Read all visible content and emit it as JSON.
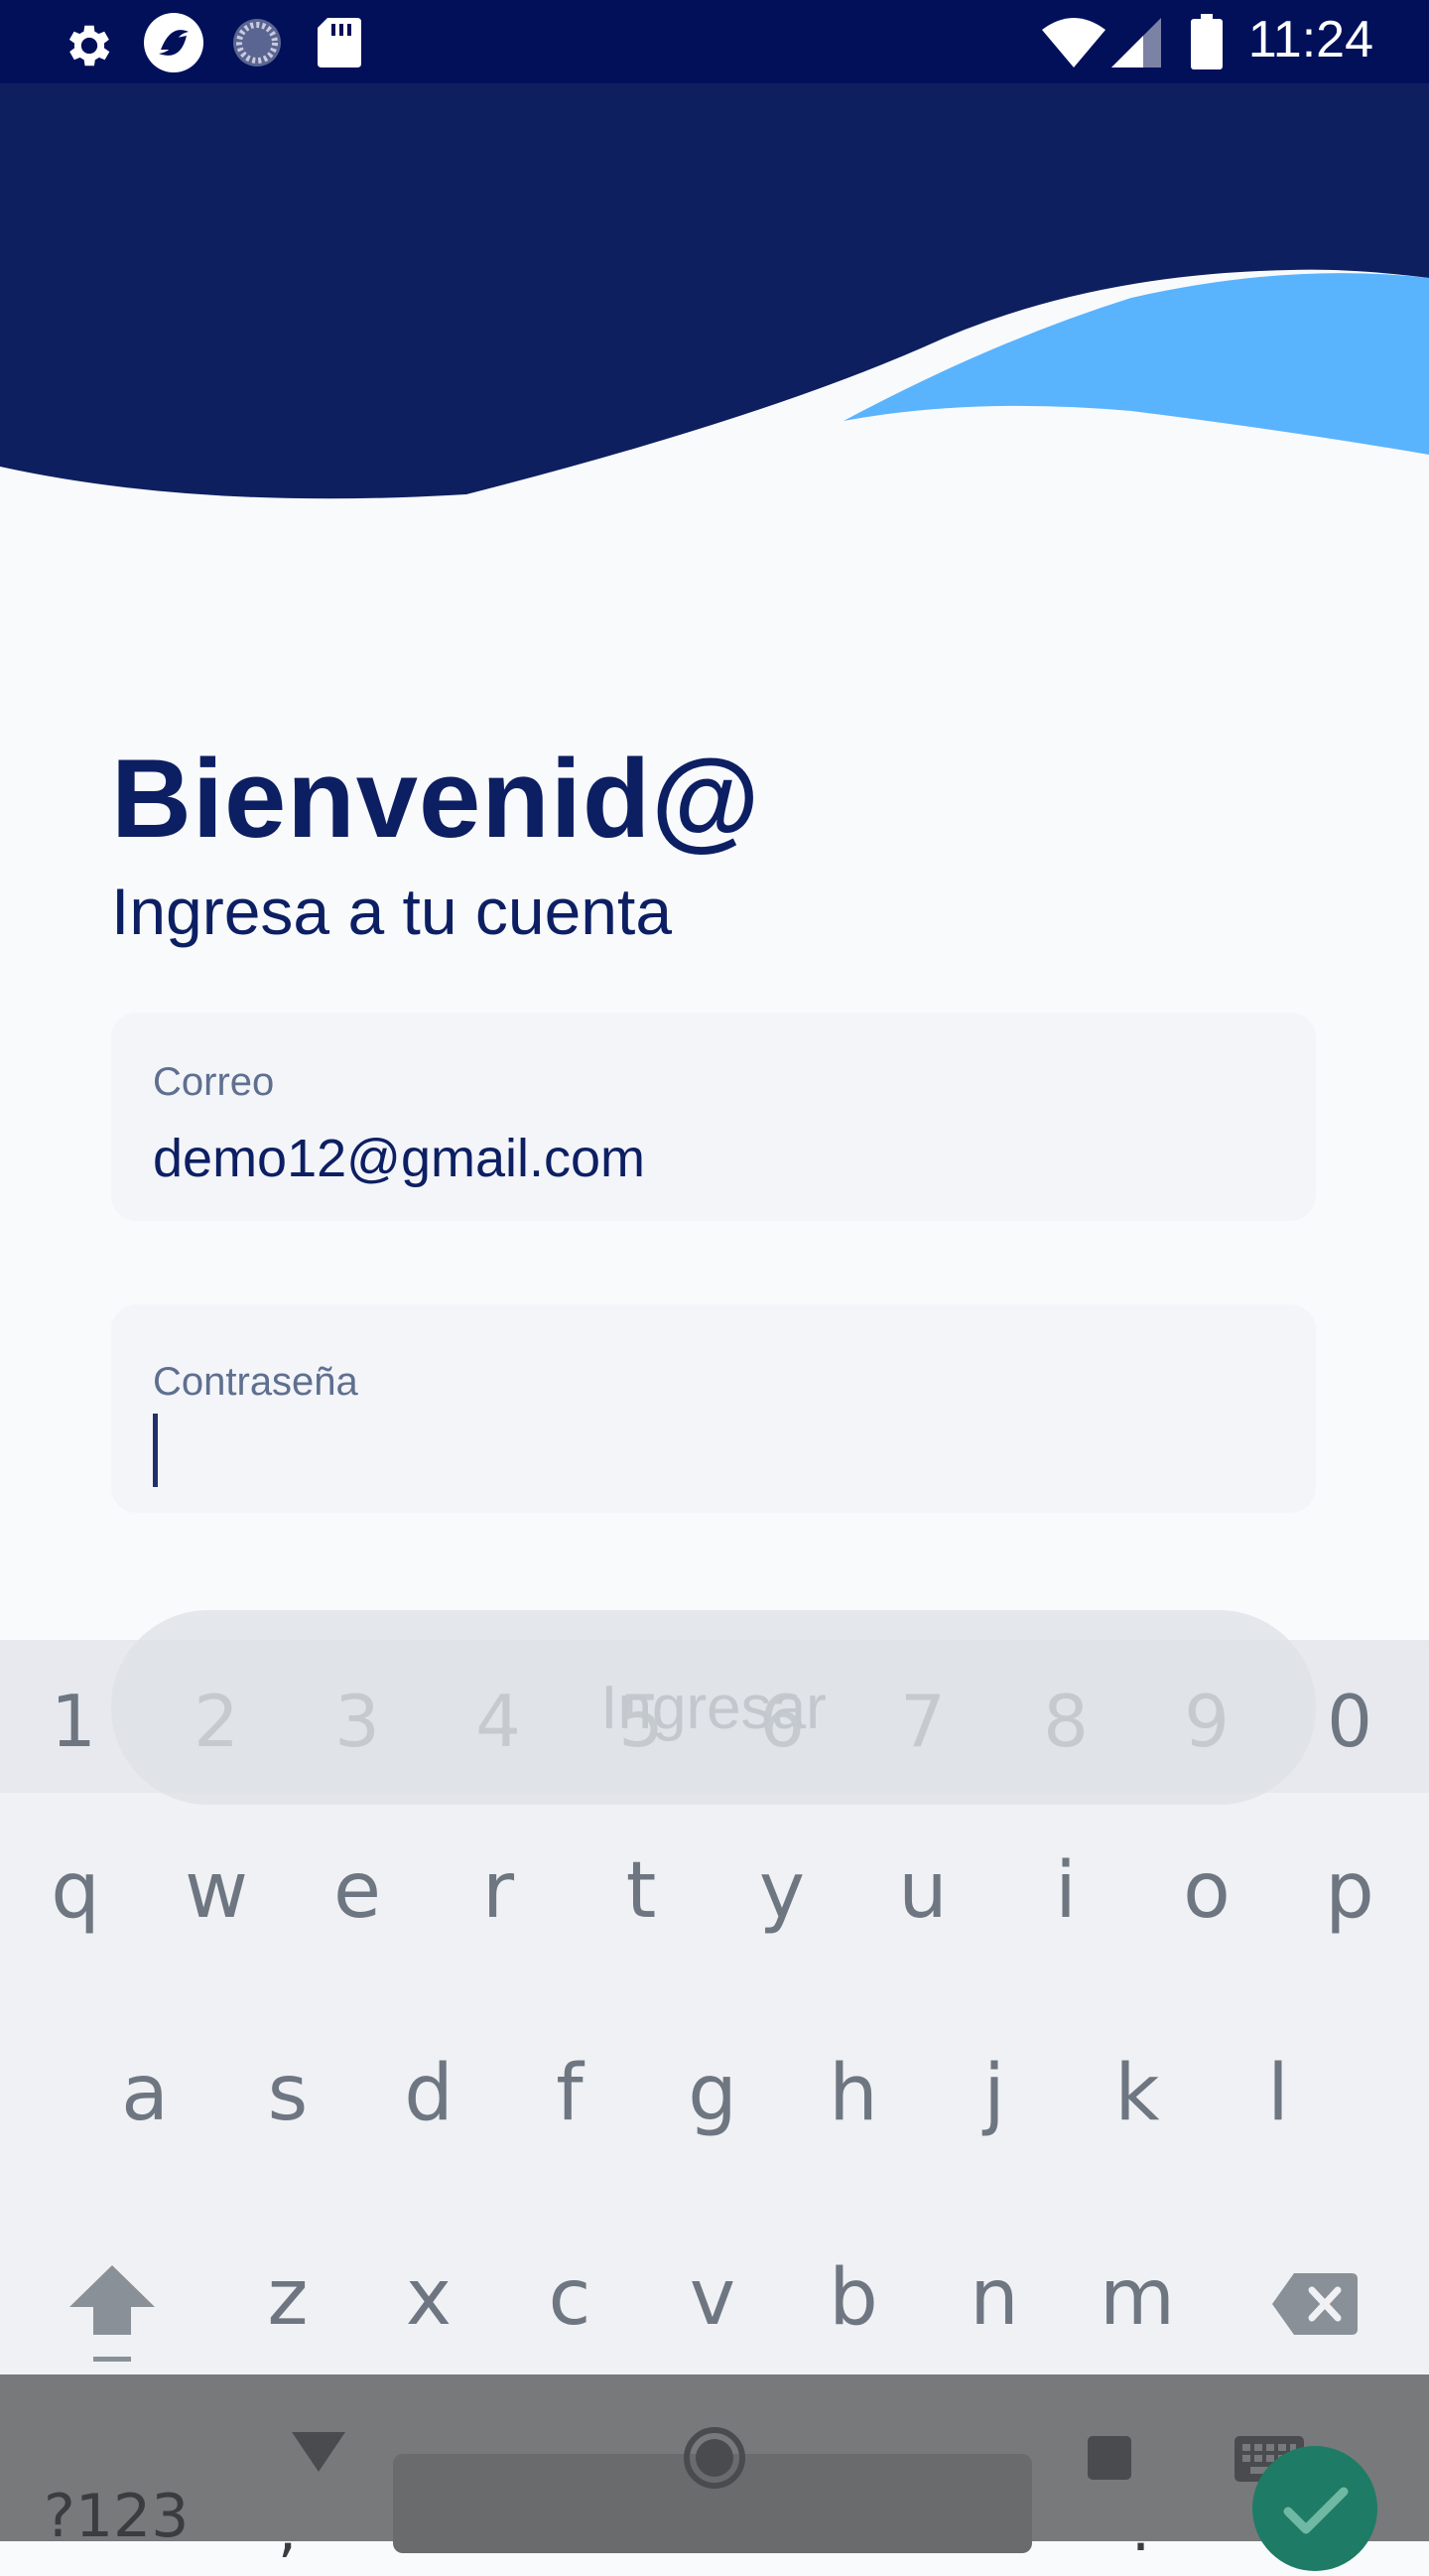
{
  "status_bar": {
    "time": "11:24",
    "icons_left": [
      "settings-gear-icon",
      "app-logo-icon",
      "sync-spinner-icon",
      "sd-card-icon"
    ],
    "icons_right": [
      "wifi-icon",
      "cell-signal-icon",
      "battery-icon"
    ],
    "background": "#02105a"
  },
  "header": {
    "wave_dark_color": "#0d1f5f",
    "wave_light_color": "#5ab3fd"
  },
  "login": {
    "title": "Bienvenid@",
    "subtitle": "Ingresa a tu cuenta",
    "email": {
      "label": "Correo",
      "value": "demo12@gmail.com"
    },
    "password": {
      "label": "Contraseña",
      "value": ""
    },
    "submit_label": "Ingresar"
  },
  "keyboard": {
    "number_row": [
      "1",
      "2",
      "3",
      "4",
      "5",
      "6",
      "7",
      "8",
      "9",
      "0"
    ],
    "row1": [
      "q",
      "w",
      "e",
      "r",
      "t",
      "y",
      "u",
      "i",
      "o",
      "p"
    ],
    "row2": [
      "a",
      "s",
      "d",
      "f",
      "g",
      "h",
      "j",
      "k",
      "l"
    ],
    "row3": [
      "z",
      "x",
      "c",
      "v",
      "b",
      "n",
      "m"
    ],
    "symbols_label": "?123",
    "comma_label": ",",
    "period_label": ".",
    "done_color": "#1e7b66"
  },
  "nav_bar": {
    "buttons": [
      "back-icon",
      "home-icon",
      "recents-icon"
    ]
  }
}
